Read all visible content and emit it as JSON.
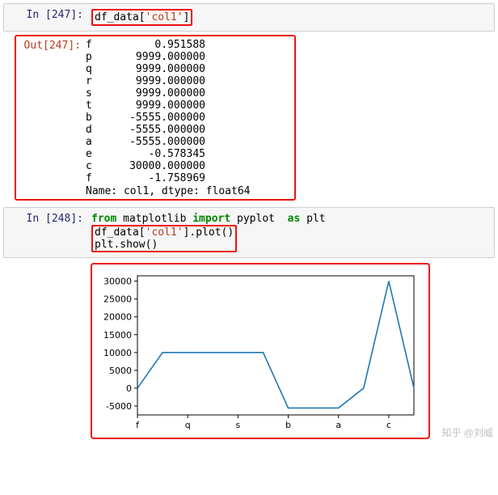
{
  "cells": {
    "input247": {
      "prompt": "In  [247]:",
      "code_prefix": "df_data[",
      "code_str": "'col1'",
      "code_suffix": "]"
    },
    "output247": {
      "prompt": "Out[247]:",
      "rows": [
        {
          "k": "f",
          "v": "0.951588"
        },
        {
          "k": "p",
          "v": "9999.000000"
        },
        {
          "k": "q",
          "v": "9999.000000"
        },
        {
          "k": "r",
          "v": "9999.000000"
        },
        {
          "k": "s",
          "v": "9999.000000"
        },
        {
          "k": "t",
          "v": "9999.000000"
        },
        {
          "k": "b",
          "v": "-5555.000000"
        },
        {
          "k": "d",
          "v": "-5555.000000"
        },
        {
          "k": "a",
          "v": "-5555.000000"
        },
        {
          "k": "e",
          "v": "-0.578345"
        },
        {
          "k": "c",
          "v": "30000.000000"
        },
        {
          "k": "f",
          "v": "-1.758969"
        }
      ],
      "dtype": "Name: col1, dtype: float64"
    },
    "input248": {
      "prompt": "In  [248]:",
      "line1_kw1": "from",
      "line1_mid": " matplotlib ",
      "line1_kw2": "import",
      "line1_mid2": " pyplot  ",
      "line1_kw3": "as",
      "line1_end": " plt",
      "line2_pre": "df_data[",
      "line2_str": "'col1'",
      "line2_post": "].plot()",
      "line3": "plt.show()"
    }
  },
  "chart_data": {
    "type": "line",
    "categories": [
      "f",
      "p",
      "q",
      "r",
      "s",
      "t",
      "b",
      "d",
      "a",
      "e",
      "c",
      "f"
    ],
    "values": [
      0.951588,
      9999,
      9999,
      9999,
      9999,
      9999,
      -5555,
      -5555,
      -5555,
      -0.578345,
      30000,
      -1.758969
    ],
    "xticks_shown": [
      "f",
      "q",
      "s",
      "b",
      "a",
      "c"
    ],
    "yticks": [
      -5000,
      0,
      5000,
      10000,
      15000,
      20000,
      25000,
      30000
    ],
    "ylim": [
      -7500,
      31500
    ],
    "title": "",
    "xlabel": "",
    "ylabel": ""
  },
  "watermark": "知乎 @刘威"
}
